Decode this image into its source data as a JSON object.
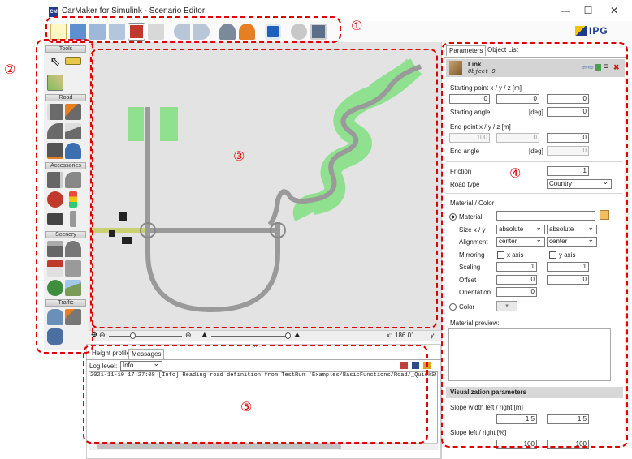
{
  "window": {
    "title": "CarMaker for Simulink - Scenario Editor",
    "app_icon": "CM",
    "min": "—",
    "max": "☐",
    "close": "✕"
  },
  "toolbar": {
    "logo": "IPG"
  },
  "tools": {
    "sections": [
      "Tools",
      "Road",
      "Accessories",
      "Scenery",
      "Traffic"
    ]
  },
  "status": {
    "x_label": "x:",
    "x_value": "186.01",
    "y_label": "y:"
  },
  "messages": {
    "tabs": [
      "Height profile",
      "Messages"
    ],
    "log_level_label": "Log level:",
    "log_level": "Info",
    "line": "2021-11-10  17:27:08 [Info]    Reading road definition from TestRun 'Examples/BasicFunctions/Road/_QuickSt"
  },
  "params": {
    "tabs": [
      "Parameters",
      "Object List"
    ],
    "object_type": "Link",
    "object_name": "Object 9",
    "start_point_label": "Starting point  x / y / z   [m]",
    "start": [
      "0",
      "0",
      "0"
    ],
    "start_angle_label": "Starting angle",
    "deg": "[deg]",
    "start_angle": "0",
    "end_point_label": "End point  x / y / z   [m]",
    "end": [
      "100",
      "0",
      "0"
    ],
    "end_angle_label": "End angle",
    "end_angle": "0",
    "friction_label": "Friction",
    "friction": "1",
    "road_type_label": "Road type",
    "road_type": "Country",
    "material_header": "Material / Color",
    "material_label": "Material",
    "size_label": "Size x / y",
    "size": [
      "absolute",
      "absolute"
    ],
    "alignment_label": "Alignment",
    "alignment": [
      "center",
      "center"
    ],
    "mirroring_label": "Mirroring",
    "x_axis": "x axis",
    "y_axis": "y axis",
    "scaling_label": "Scaling",
    "scaling": [
      "1",
      "1"
    ],
    "offset_label": "Offset",
    "offset": [
      "0",
      "0"
    ],
    "orientation_label": "Orientation",
    "orientation": "0",
    "color_label": "Color",
    "preview_label": "Material preview:",
    "vis_header": "Visualization parameters",
    "slope_width_label": "Slope width left / right   [m]",
    "slope_width": [
      "1.5",
      "1.5"
    ],
    "slope_label": "Slope left / right   [%]",
    "slope": [
      "100",
      "100"
    ]
  },
  "annotations": [
    "①",
    "②",
    "③",
    "④",
    "⑤"
  ]
}
